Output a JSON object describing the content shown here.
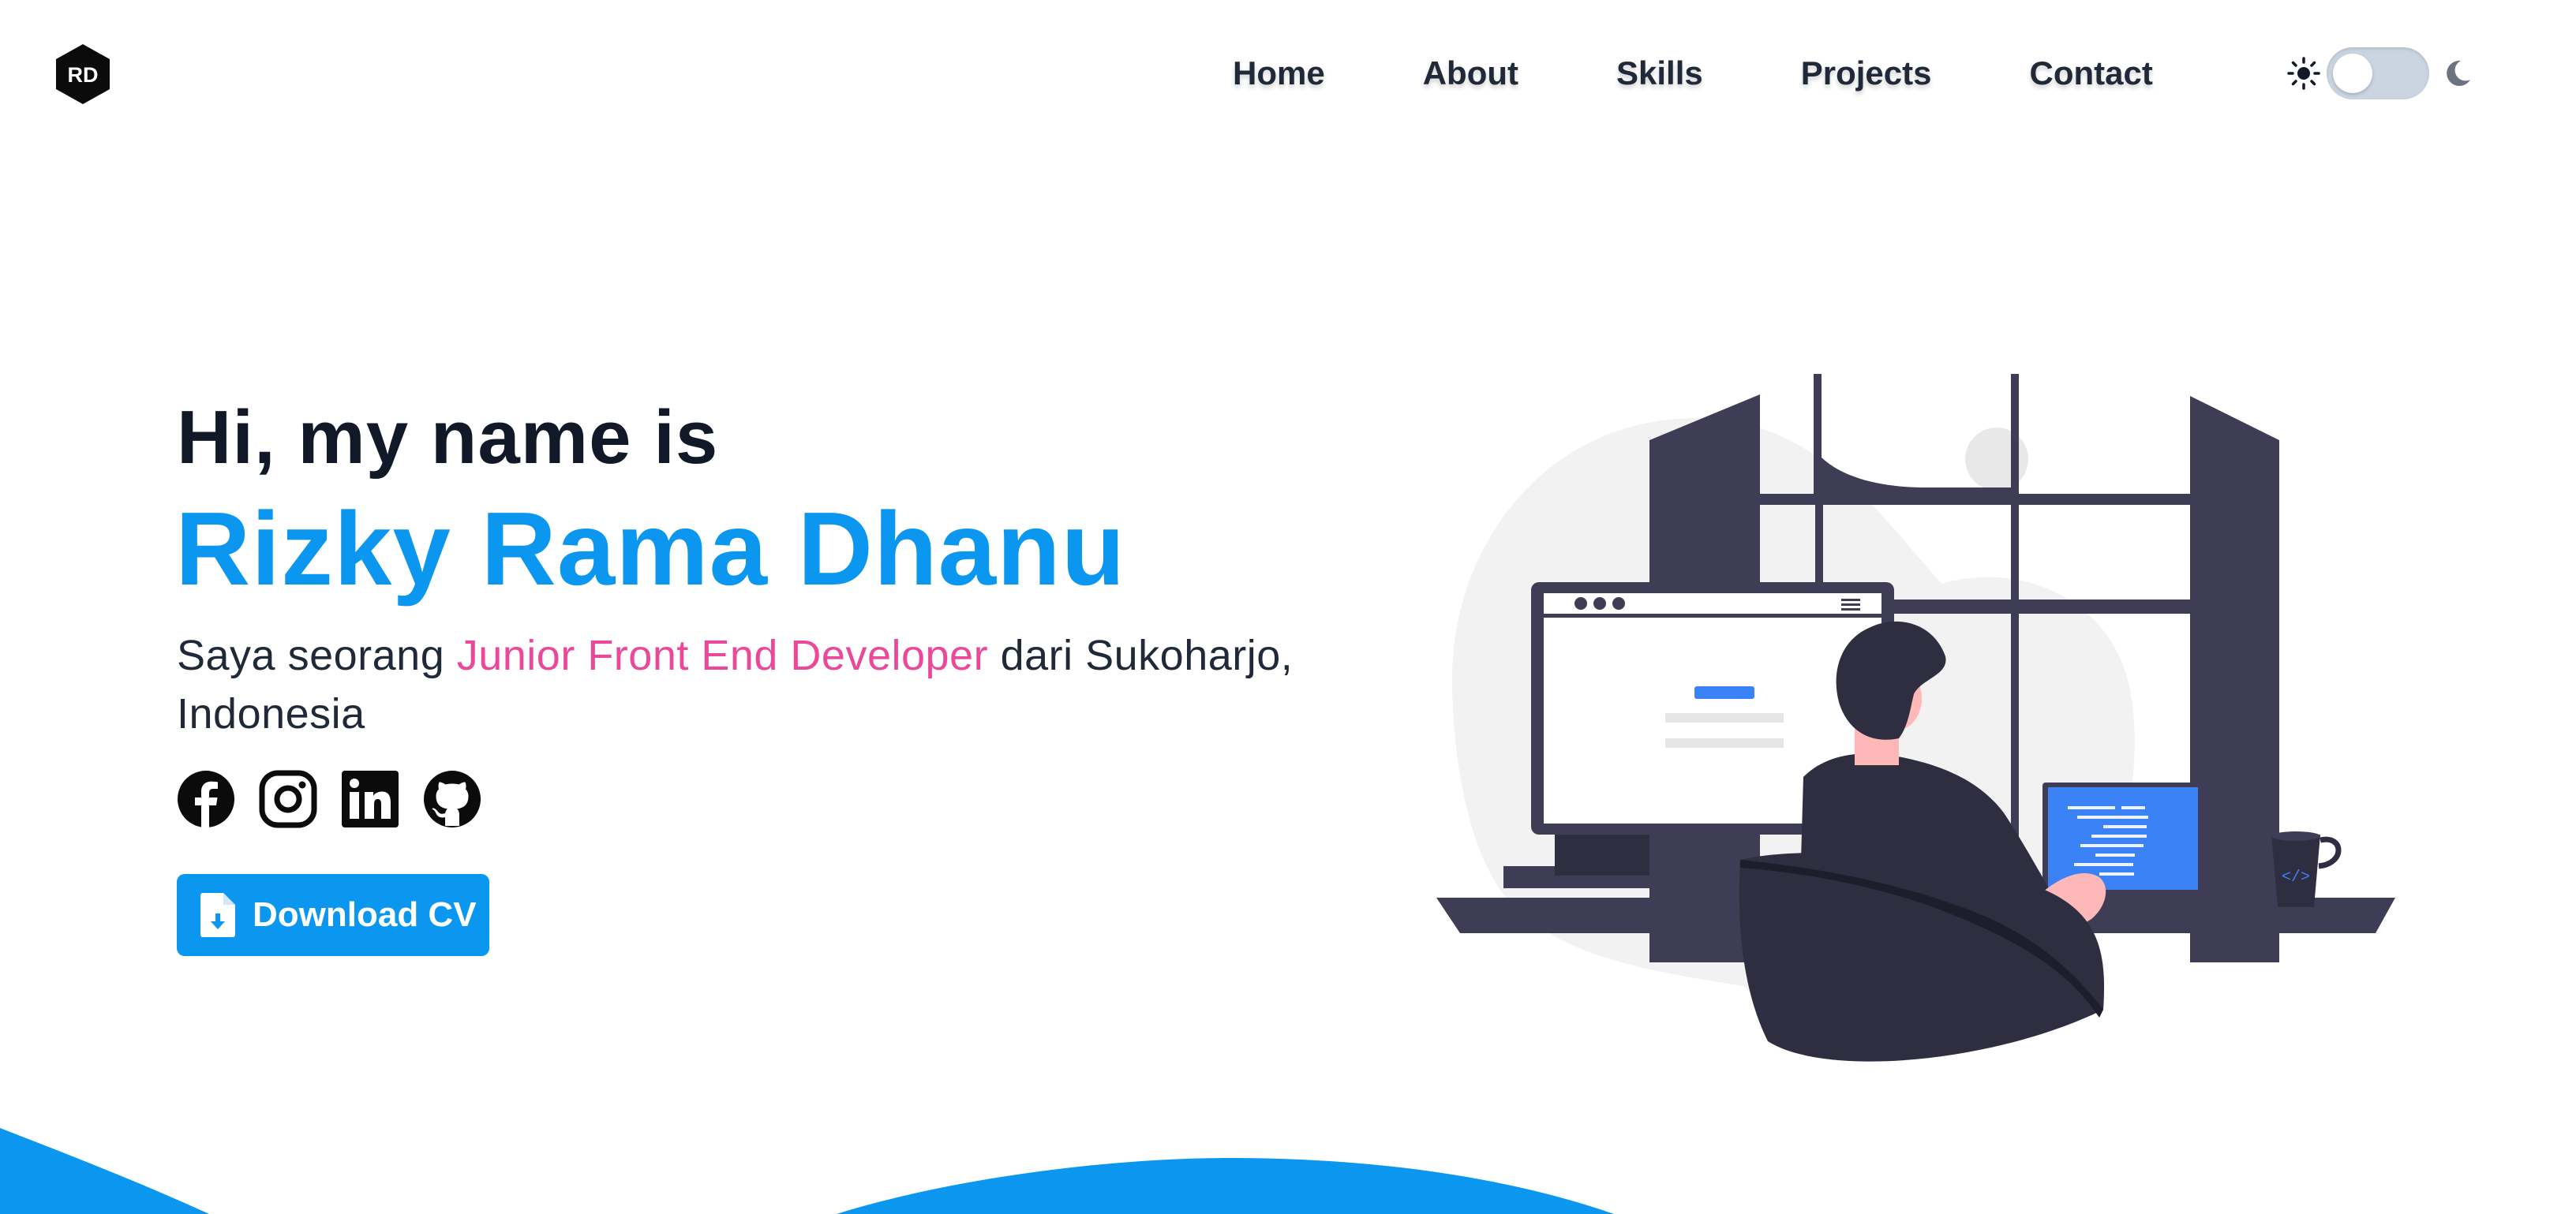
{
  "header": {
    "logo": {
      "text": "RD",
      "icon": "rd-hexagon-logo"
    },
    "nav": [
      {
        "label": "Home"
      },
      {
        "label": "About"
      },
      {
        "label": "Skills"
      },
      {
        "label": "Projects"
      },
      {
        "label": "Contact"
      }
    ],
    "theme_toggle": {
      "sun_icon": "sun-icon",
      "moon_icon": "moon-icon",
      "state": "light"
    }
  },
  "hero": {
    "greeting": "Hi, my name is",
    "name": "Rizky Rama Dhanu",
    "intro_before": "Saya seorang ",
    "intro_highlight": "Junior Front End Developer",
    "intro_after": " dari Sukoharjo, Indonesia",
    "socials": [
      {
        "icon": "facebook-icon"
      },
      {
        "icon": "instagram-icon"
      },
      {
        "icon": "linkedin-icon"
      },
      {
        "icon": "github-icon"
      }
    ],
    "cv_button": {
      "label": "Download CV",
      "icon": "file-download-icon"
    }
  },
  "colors": {
    "accent_blue": "#0b97ef",
    "accent_pink": "#ec4899",
    "text_dark": "#111827",
    "toggle_track": "#cbd5e1",
    "illustration_dark": "#3f3d56"
  }
}
